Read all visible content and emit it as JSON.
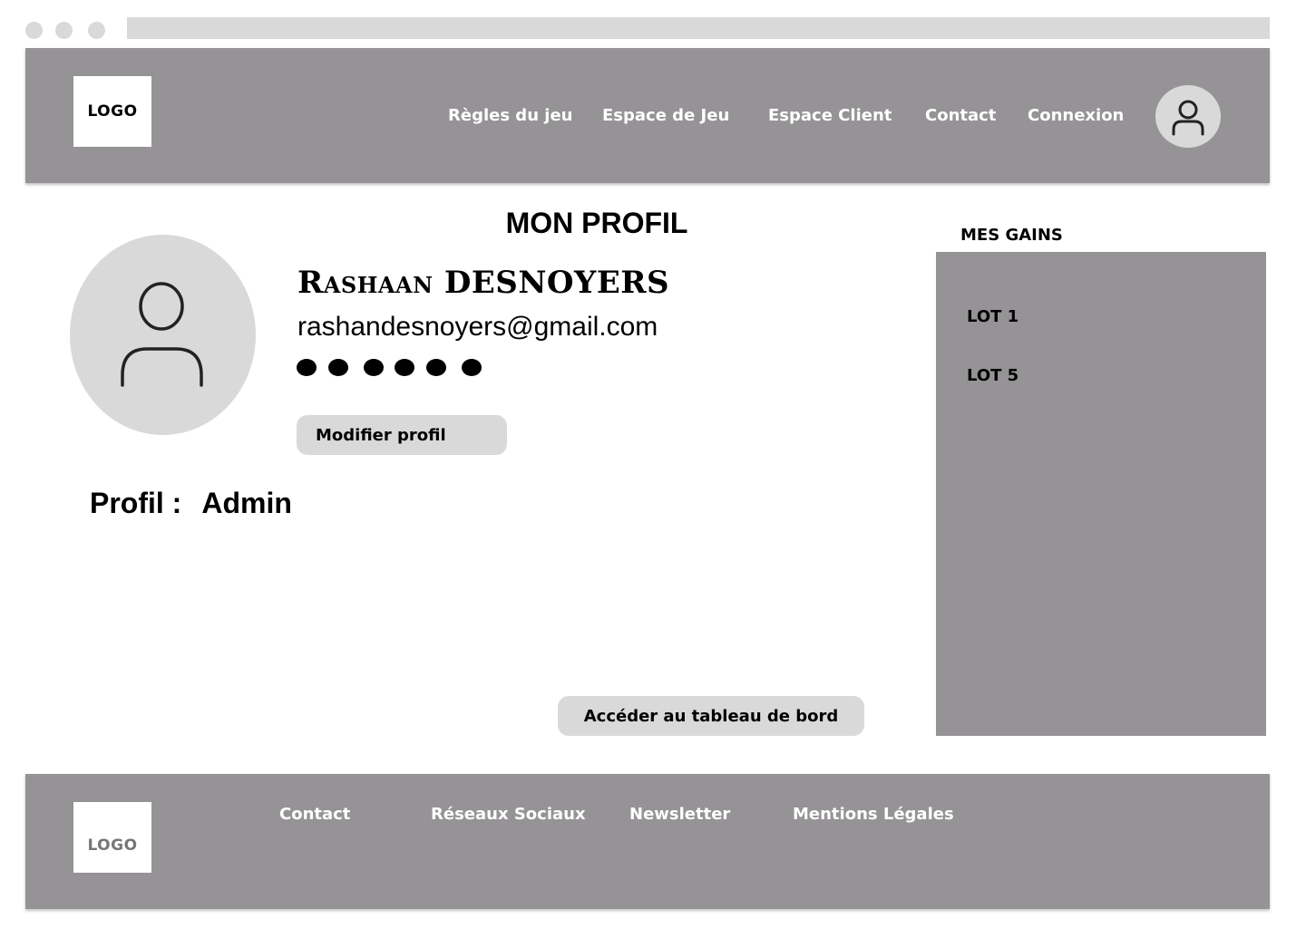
{
  "header": {
    "logo": "LOGO",
    "nav": [
      {
        "label": "Règles du jeu"
      },
      {
        "label": "Espace de Jeu"
      },
      {
        "label": "Espace Client"
      },
      {
        "label": "Contact"
      },
      {
        "label": "Connexion"
      }
    ],
    "account_icon": "user-icon"
  },
  "main": {
    "title": "MON PROFIL",
    "photo_icon": "user-icon",
    "name": "Rashaan DESNOYERS",
    "email": "rashandesnoyers@gmail.com",
    "password_mask": "●●●●●●",
    "edit_button": "Modifier profil",
    "role_label": "Profil :",
    "role_value": "Admin",
    "dashboard_button": "Accéder au tableau de bord"
  },
  "gains": {
    "title": "MES GAINS",
    "items": [
      {
        "label": "LOT 1"
      },
      {
        "label": "LOT 5"
      }
    ]
  },
  "footer": {
    "logo": "LOGO",
    "links": [
      {
        "label": "Contact"
      },
      {
        "label": "Réseaux Sociaux"
      },
      {
        "label": "Newsletter"
      },
      {
        "label": "Mentions Légales"
      }
    ]
  },
  "colors": {
    "bar": "#959395",
    "light": "#d9d9d9"
  }
}
